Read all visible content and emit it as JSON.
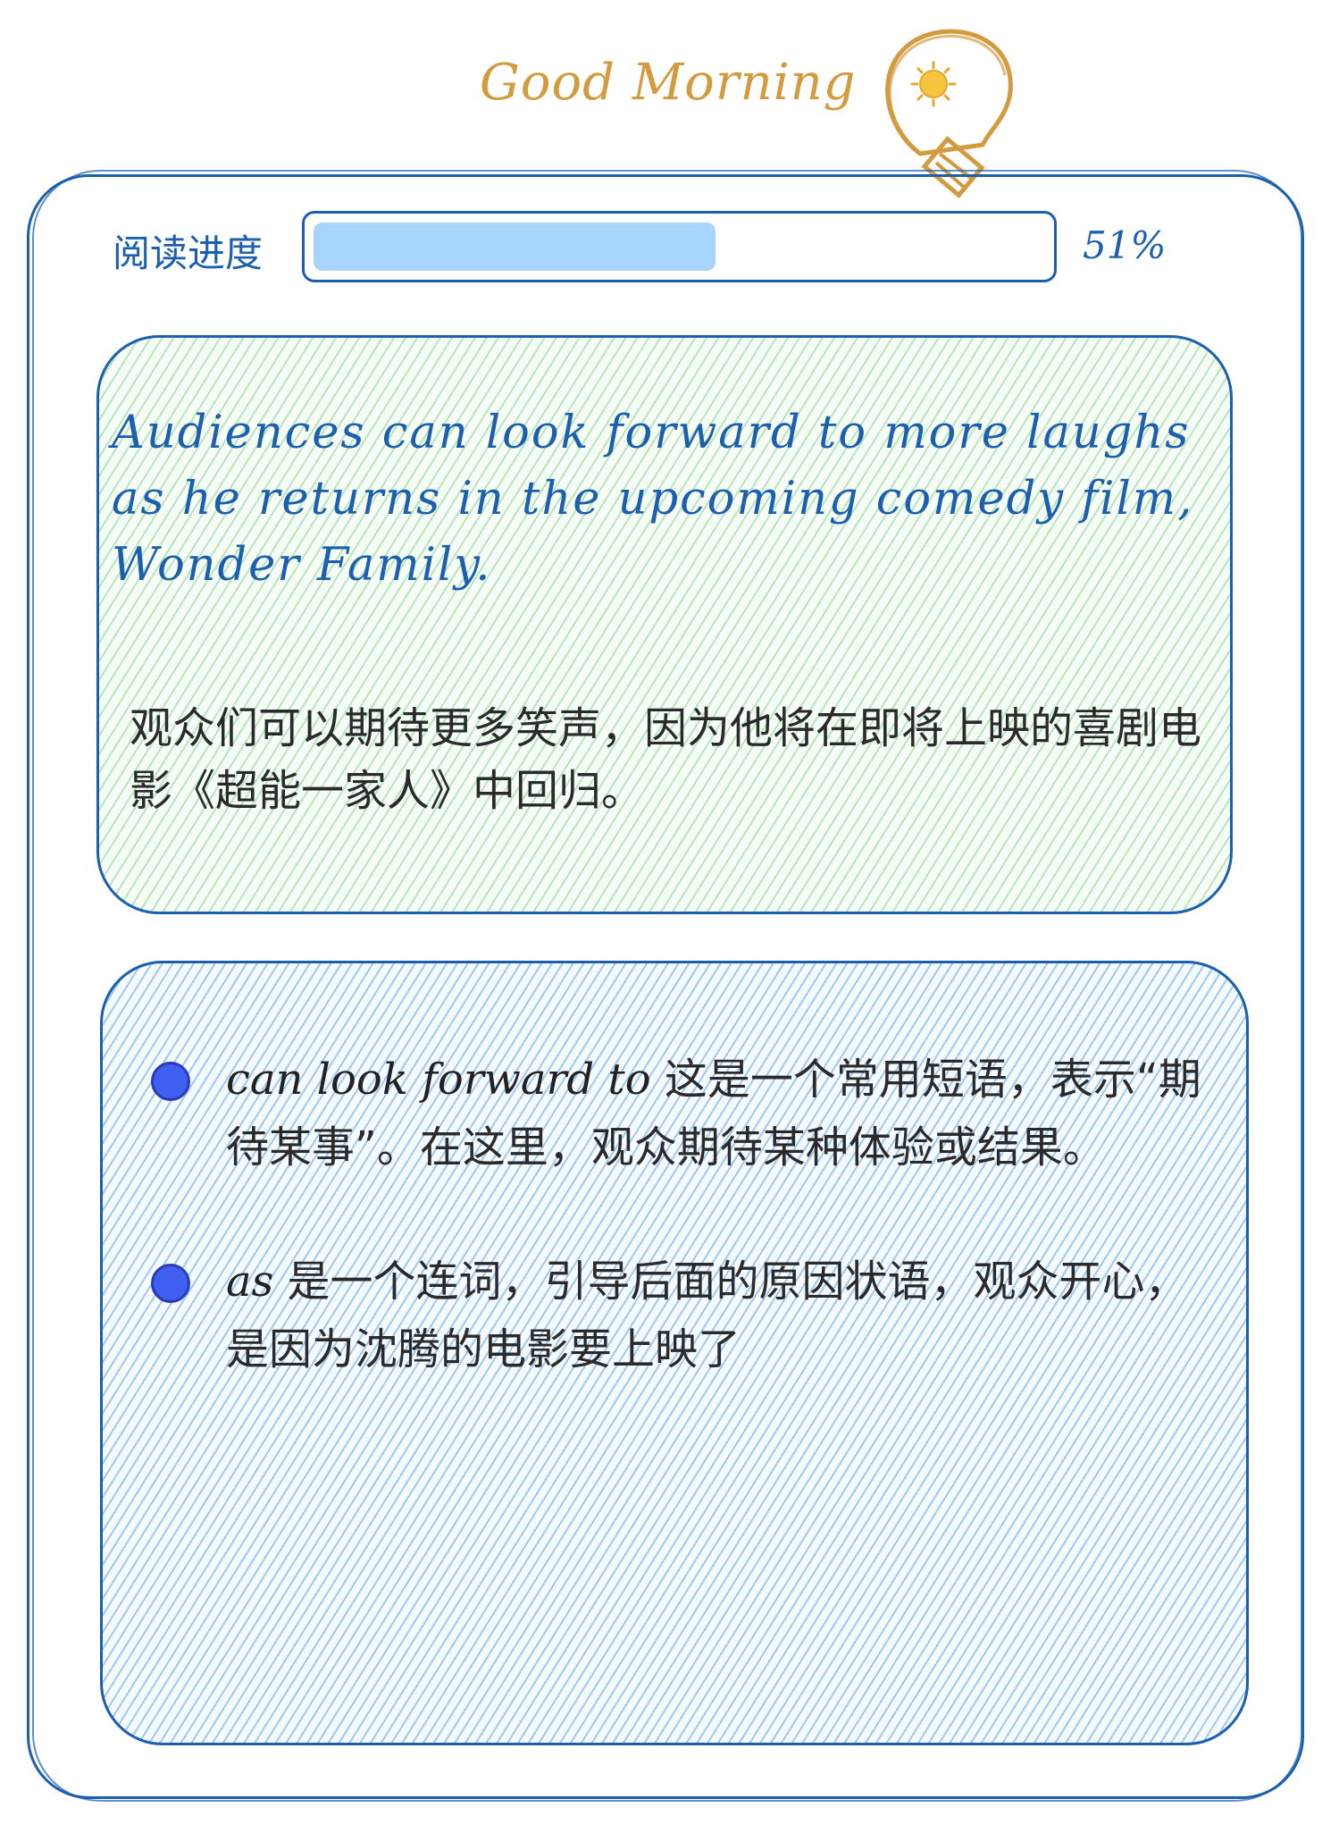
{
  "header": {
    "greeting": "Good Morning"
  },
  "progress": {
    "label": "阅读进度",
    "percent_text": "51%",
    "fraction": 0.55
  },
  "sentence_card": {
    "english": "Audiences can look forward to more laughs as he returns in the upcoming comedy film, Wonder Family.",
    "chinese": "观众们可以期待更多笑声，因为他将在即将上映的喜剧电影《超能一家人》中回归。"
  },
  "notes": [
    {
      "term": "can look forward to",
      "explanation": " 这是一个常用短语，表示“期待某事”。在这里，观众期待某种体验或结果。"
    },
    {
      "term": "as",
      "explanation": " 是一个连词，引导后面的原因状语，观众开心，是因为沈腾的电影要上映了"
    }
  ],
  "colors": {
    "accent": "#1c5fae",
    "greeting": "#d49b3e",
    "progress_fill": "#a7d4fb",
    "bullet": "#3f5ff0"
  },
  "icons": {
    "header": "lightbulb-sun-icon"
  }
}
